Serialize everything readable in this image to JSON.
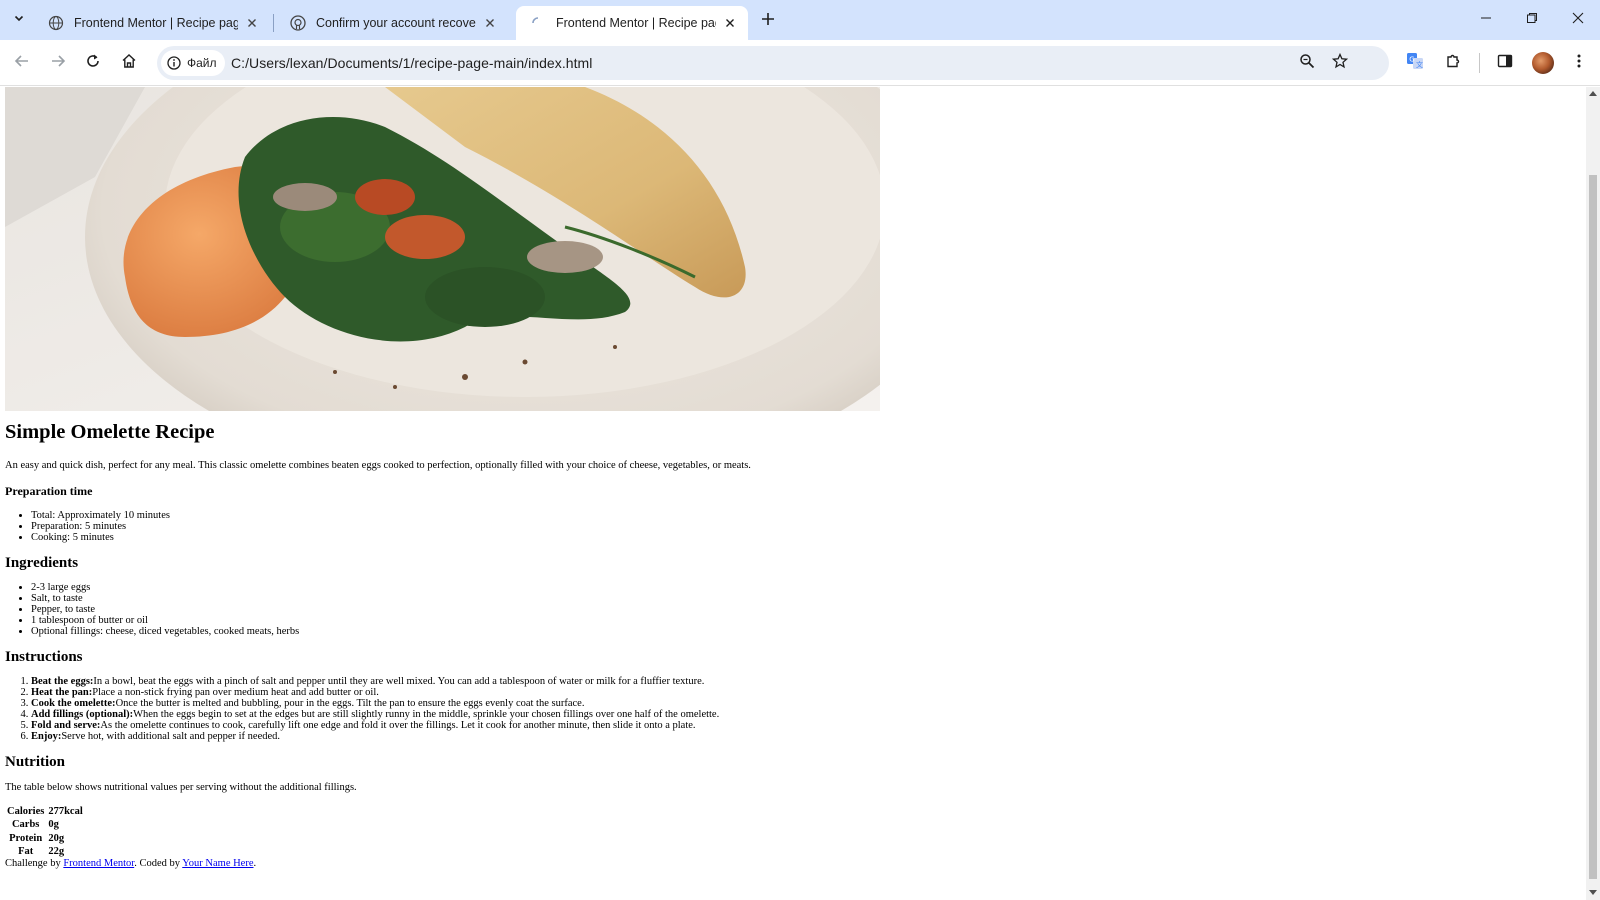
{
  "browser": {
    "tabs": [
      {
        "title": "Frontend Mentor | Recipe page",
        "active": false
      },
      {
        "title": "Confirm your account recovery",
        "active": false
      },
      {
        "title": "Frontend Mentor | Recipe page",
        "active": true
      }
    ],
    "chip_label": "Файл",
    "url": "C:/Users/lexan/Documents/1/recipe-page-main/index.html",
    "accent_color": "#d3e3fd"
  },
  "recipe": {
    "title": "Simple Omelette Recipe",
    "description": "An easy and quick dish, perfect for any meal. This classic omelette combines beaten eggs cooked to perfection, optionally filled with your choice of cheese, vegetables, or meats.",
    "prep_heading": "Preparation time",
    "prep_items": [
      "Total: Approximately 10 minutes",
      "Preparation: 5 minutes",
      "Cooking: 5 minutes"
    ],
    "ingredients_heading": "Ingredients",
    "ingredients": [
      "2-3 large eggs",
      "Salt, to taste",
      "Pepper, to taste",
      "1 tablespoon of butter or oil",
      "Optional fillings: cheese, diced vegetables, cooked meats, herbs"
    ],
    "instructions_heading": "Instructions",
    "instructions": [
      {
        "title": "Beat the eggs:",
        "text": "In a bowl, beat the eggs with a pinch of salt and pepper until they are well mixed. You can add a tablespoon of water or milk for a fluffier texture."
      },
      {
        "title": "Heat the pan:",
        "text": "Place a non-stick frying pan over medium heat and add butter or oil."
      },
      {
        "title": "Cook the omelette:",
        "text": "Once the butter is melted and bubbling, pour in the eggs. Tilt the pan to ensure the eggs evenly coat the surface."
      },
      {
        "title": "Add fillings (optional):",
        "text": "When the eggs begin to set at the edges but are still slightly runny in the middle, sprinkle your chosen fillings over one half of the omelette."
      },
      {
        "title": "Fold and serve:",
        "text": "As the omelette continues to cook, carefully lift one edge and fold it over the fillings. Let it cook for another minute, then slide it onto a plate."
      },
      {
        "title": "Enjoy:",
        "text": "Serve hot, with additional salt and pepper if needed."
      }
    ],
    "nutrition_heading": "Nutrition",
    "nutrition_description": "The table below shows nutritional values per serving without the additional fillings.",
    "nutrition": [
      {
        "label": "Calories",
        "value": "277kcal"
      },
      {
        "label": "Carbs",
        "value": "0g"
      },
      {
        "label": "Protein",
        "value": "20g"
      },
      {
        "label": "Fat",
        "value": "22g"
      }
    ],
    "footer": {
      "prefix": "Challenge by",
      "link1": "Frontend Mentor",
      "middle": ". Coded by",
      "link2": "Your Name Here",
      "suffix": "."
    }
  }
}
